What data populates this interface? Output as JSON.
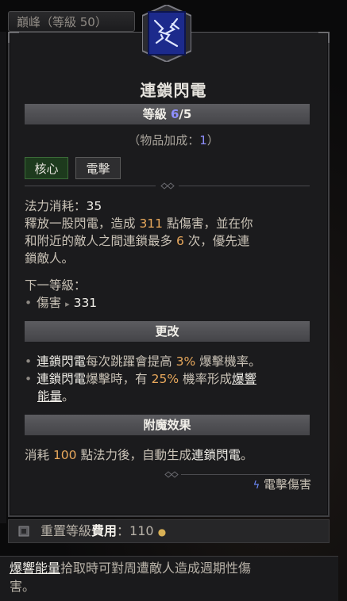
{
  "paragon_tab": "巔峰（等級 50）",
  "skill": {
    "name": "連鎖閃電",
    "rank_prefix": "等級 ",
    "rank_current": "6",
    "rank_max": "/5",
    "bonus_prefix": "（物品加成：",
    "bonus_value": "1",
    "bonus_suffix": "）",
    "tags": [
      "核心",
      "電擊"
    ]
  },
  "description": {
    "mana_cost_label": "法力消耗：",
    "mana_cost_value": "35",
    "line1_a": "釋放一股閃電，造成 ",
    "damage_value": "311",
    "line1_b": " 點傷害，並在你",
    "line2_a": "和附近的敵人之間連鎖最多 ",
    "chain_count": "6",
    "line2_b": " 次，優先連",
    "line3": "鎖敵人。",
    "next_rank_label": "下一等級：",
    "next_rank_item": "傷害",
    "next_rank_arrow": "▸",
    "next_rank_value": "331"
  },
  "modifications": {
    "header": "更改",
    "item1_skill": "連鎖閃電",
    "item1_a": "每次跳躍會提高 ",
    "item1_value": "3%",
    "item1_b": " 爆擊機率。",
    "item2_skill": "連鎖閃電",
    "item2_a": "爆擊時，有 ",
    "item2_value": "25%",
    "item2_b": " 機率形成",
    "item2_link1": "爆響",
    "item2_link2": "能量",
    "item2_end": "。"
  },
  "enchantment": {
    "header": "附魔效果",
    "text_a": "消耗 ",
    "value": "100",
    "text_b": " 點法力後，自動生成",
    "skill": "連鎖閃電",
    "text_end": "。"
  },
  "damage_type": "電擊傷害",
  "reset_cost": {
    "label_a": "重置等級",
    "label_b": "費用",
    "colon": "：",
    "value": "110"
  },
  "glossary": {
    "term": "爆響能量",
    "text_a": "拾取時可對周遭敵人造成週期性傷",
    "text_b": "害。"
  },
  "colors": {
    "rank_blue": "#8f8fff",
    "value_orange": "#e8a85c",
    "core_tag_green": "#1d3a1d",
    "lightning_blue": "#6f8cff"
  }
}
